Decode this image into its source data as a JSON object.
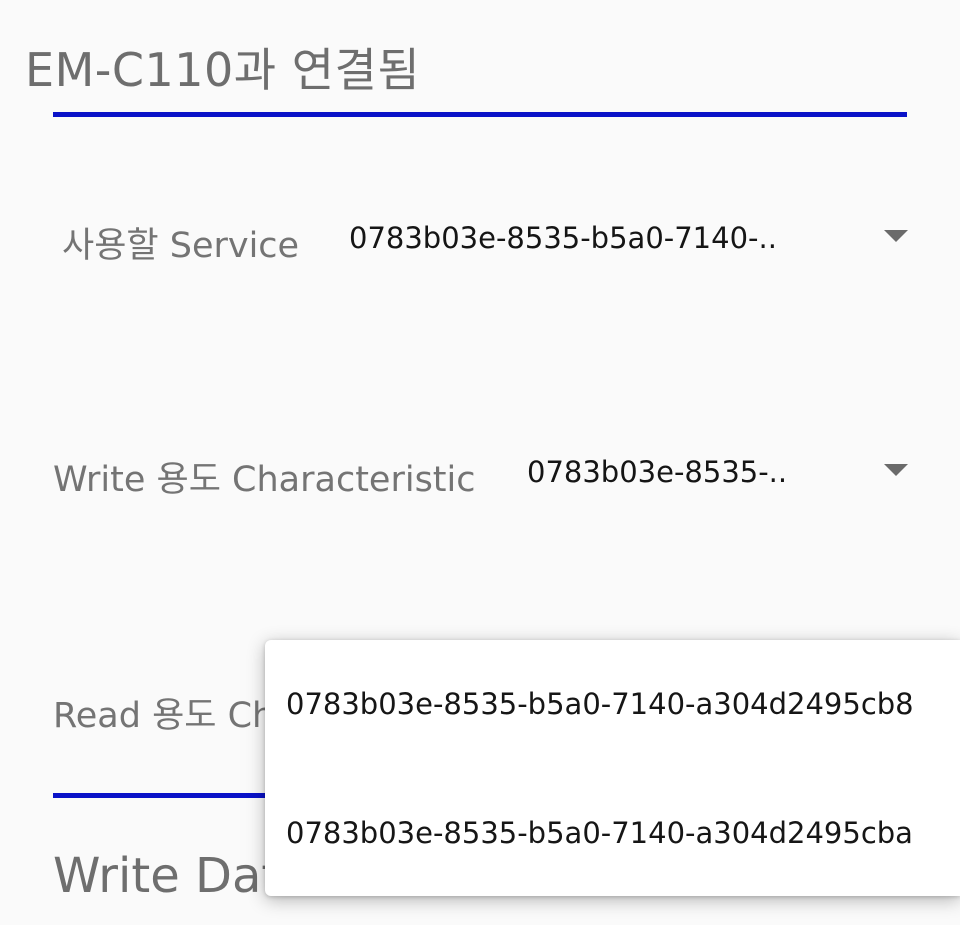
{
  "header": {
    "title": "EM-C110과 연결됨"
  },
  "service_row": {
    "label": "사용할 Service",
    "selected_value": "0783b03e-8535-b5a0-7140-.."
  },
  "write_row": {
    "label": "Write 용도 Characteristic",
    "selected_value": "0783b03e-8535-.."
  },
  "read_row": {
    "label": "Read 용도 Ch"
  },
  "write_data": {
    "heading": "Write Data"
  },
  "dropdown": {
    "options": [
      "0783b03e-8535-b5a0-7140-a304d2495cb8",
      "0783b03e-8535-b5a0-7140-a304d2495cba"
    ]
  }
}
